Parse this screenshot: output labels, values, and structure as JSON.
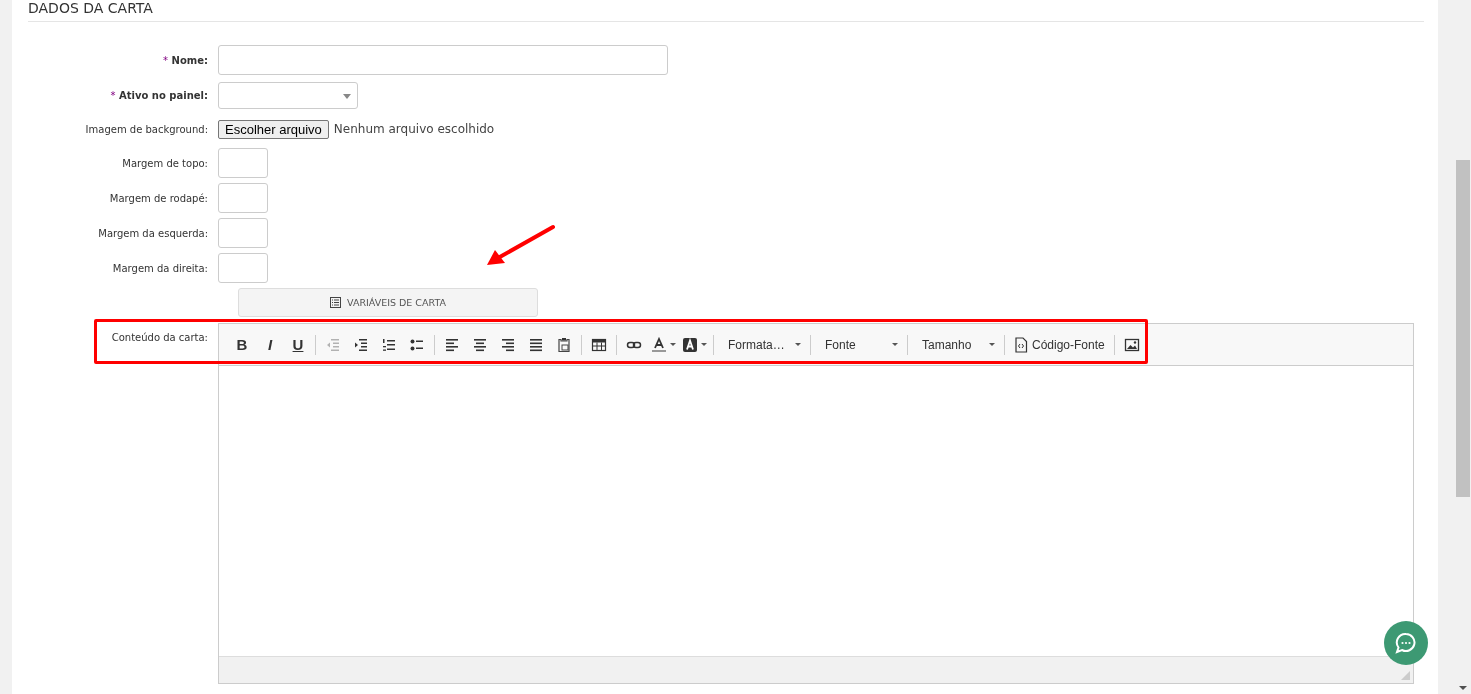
{
  "section_title": "DADOS DA CARTA",
  "required_mark": "*",
  "fields": [
    {
      "kind": "text",
      "label": "Nome:",
      "required": true
    },
    {
      "kind": "select",
      "label": "Ativo no painel:",
      "required": true
    },
    {
      "kind": "file",
      "label": "Imagem de background:",
      "required": false,
      "button": "Escolher arquivo",
      "status": "Nenhum arquivo escolhido"
    },
    {
      "kind": "small",
      "label": "Margem de topo:",
      "required": false
    },
    {
      "kind": "small",
      "label": "Margem de rodapé:",
      "required": false
    },
    {
      "kind": "small",
      "label": "Margem da esquerda:",
      "required": false
    },
    {
      "kind": "small",
      "label": "Margem da direita:",
      "required": false
    }
  ],
  "variables_button": "VARIÁVEIS DE CARTA",
  "editor": {
    "label": "Conteúdo da carta:",
    "toolbar": [
      [
        {
          "kind": "glyph",
          "text": "B",
          "disabled": false
        },
        {
          "kind": "glyph",
          "text": "I",
          "disabled": false
        },
        {
          "kind": "glyph",
          "text": "U",
          "disabled": false
        }
      ],
      [
        {
          "kind": "icon",
          "disabled": true
        },
        {
          "kind": "icon",
          "disabled": false
        },
        {
          "kind": "icon",
          "disabled": false
        },
        {
          "kind": "icon",
          "disabled": false
        }
      ],
      [
        {
          "kind": "icon",
          "disabled": false
        },
        {
          "kind": "icon",
          "disabled": false
        },
        {
          "kind": "icon",
          "disabled": false
        },
        {
          "kind": "icon",
          "disabled": false
        },
        {
          "kind": "icon",
          "disabled": false
        }
      ],
      [
        {
          "kind": "icon",
          "disabled": false
        }
      ],
      [
        {
          "kind": "icon",
          "disabled": false
        },
        {
          "kind": "color",
          "disabled": false
        },
        {
          "kind": "color",
          "disabled": false
        }
      ],
      [
        {
          "kind": "dropdown",
          "label": "Formata…"
        }
      ],
      [
        {
          "kind": "dropdown",
          "label": "Fonte"
        }
      ],
      [
        {
          "kind": "dropdown",
          "label": "Tamanho"
        }
      ],
      [
        {
          "kind": "source",
          "label": "Código-Fonte"
        }
      ],
      [
        {
          "kind": "icon",
          "disabled": false
        }
      ]
    ]
  }
}
